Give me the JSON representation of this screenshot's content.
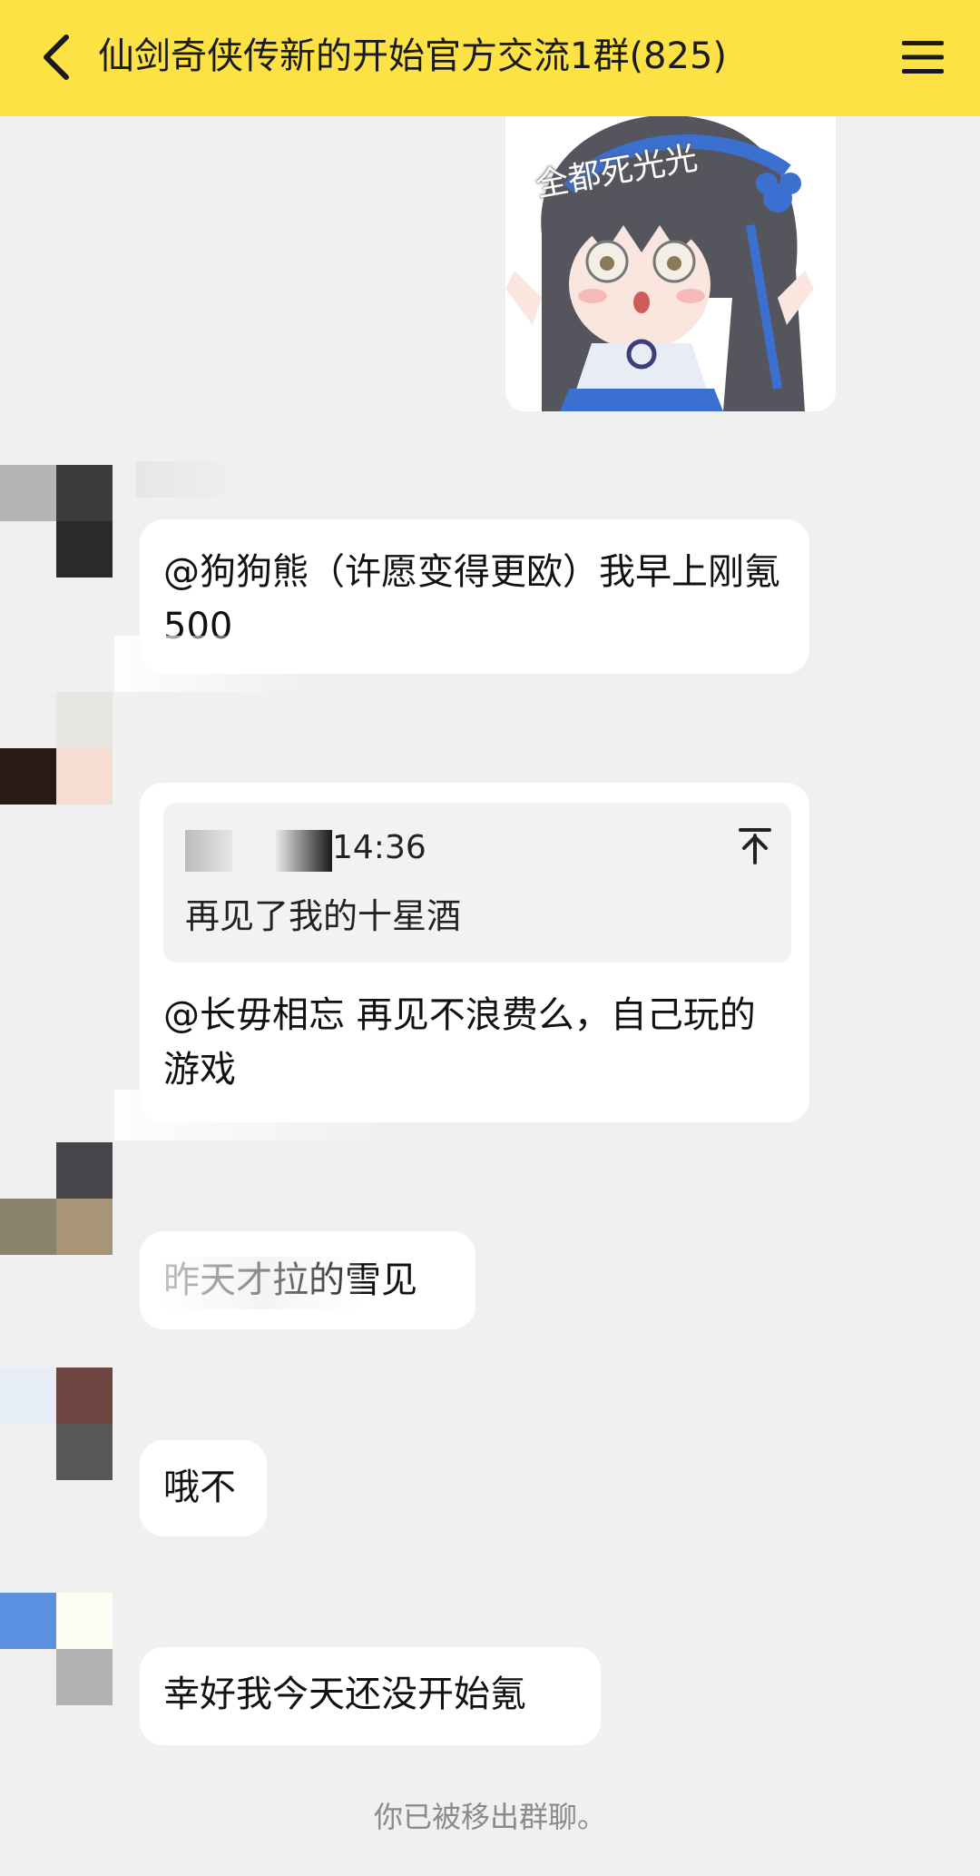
{
  "header": {
    "title": "仙剑奇侠传新的开始官方交流1群(825)",
    "back_icon": "chevron-left-icon",
    "menu_icon": "hamburger-menu-icon",
    "background": "#fde245"
  },
  "sticker": {
    "caption": "全都死光光"
  },
  "messages": [
    {
      "text": "@狗狗熊（许愿变得更欧）我早上刚氪500"
    },
    {
      "quote": {
        "time": "14:36",
        "text": "再见了我的十星酒"
      },
      "text": "@长毋相忘 再见不浪费么，自己玩的游戏"
    },
    {
      "text": "昨天才拉的雪见"
    },
    {
      "text": "哦不"
    },
    {
      "text": "幸好我今天还没开始氪"
    }
  ],
  "system_notice": "你已被移出群聊。",
  "colors": {
    "chat_background": "#f0f0f0",
    "bubble": "#ffffff",
    "notice_text": "#8a8a8a"
  }
}
